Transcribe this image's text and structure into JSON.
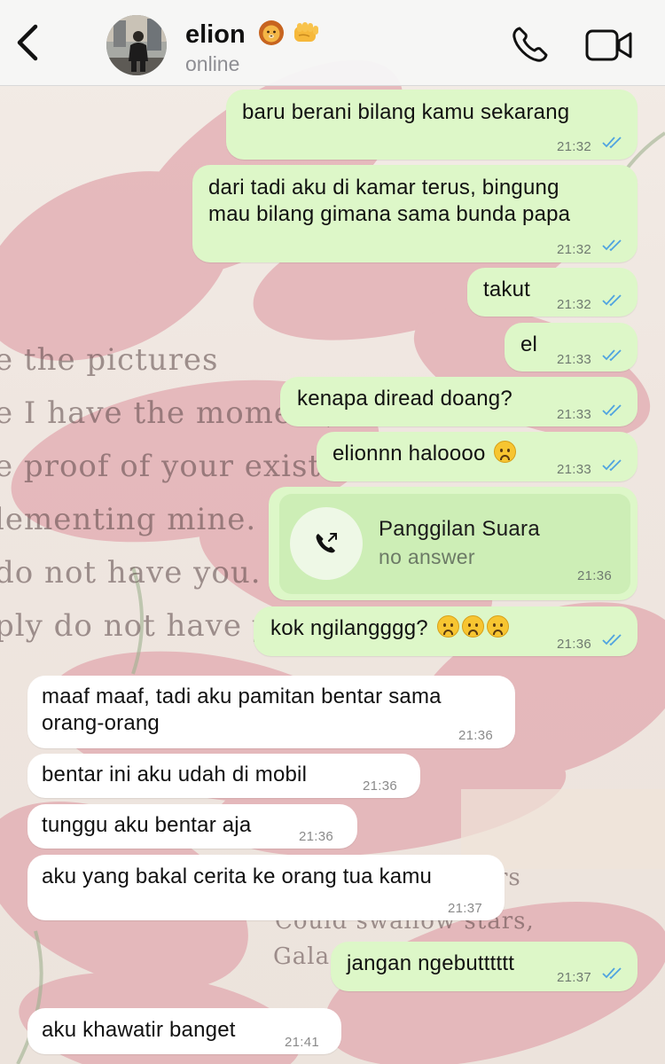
{
  "header": {
    "contact_name": "elion",
    "contact_status": "online"
  },
  "wallpaper": {
    "lines": [
      "e the pictures",
      "e I have the moment,",
      "e proof of your existe",
      "lementing mine.",
      "do not have you.",
      "ply do not have yo"
    ],
    "lower": [
      "rs",
      "Could swallow stars,",
      "Gala"
    ]
  },
  "colors": {
    "outgoing_bubble": "#ddf7c8",
    "incoming_bubble": "#ffffff",
    "read_ticks": "#4fa3e0",
    "call_card": "#cdeeb6"
  },
  "messages": [
    {
      "dir": "out",
      "lines": [
        "baru berani bilang kamu sekarang"
      ],
      "time": "21:32",
      "ticks": "read"
    },
    {
      "dir": "out",
      "lines": [
        "dari tadi aku di kamar terus, bingung",
        "mau bilang gimana sama bunda papa"
      ],
      "time": "21:32",
      "ticks": "read"
    },
    {
      "dir": "out",
      "lines": [
        "takut"
      ],
      "time": "21:32",
      "ticks": "read"
    },
    {
      "dir": "out",
      "lines": [
        "el"
      ],
      "time": "21:33",
      "ticks": "read"
    },
    {
      "dir": "out",
      "lines": [
        "kenapa diread doang?"
      ],
      "time": "21:33",
      "ticks": "read"
    },
    {
      "dir": "out",
      "lines": [
        "elionnn haloooo"
      ],
      "emoji_count": 1,
      "time": "21:33",
      "ticks": "read"
    },
    {
      "dir": "out",
      "type": "call",
      "title": "Panggilan Suara",
      "subtitle": "no answer",
      "time": "21:36"
    },
    {
      "dir": "out",
      "lines": [
        "kok ngilangggg?"
      ],
      "emoji_count": 3,
      "time": "21:36",
      "ticks": "read"
    },
    {
      "dir": "in",
      "lines": [
        "maaf maaf, tadi aku pamitan bentar sama",
        "orang-orang"
      ],
      "time": "21:36"
    },
    {
      "dir": "in",
      "lines": [
        "bentar ini aku udah di mobil"
      ],
      "time": "21:36"
    },
    {
      "dir": "in",
      "lines": [
        "tunggu aku bentar aja"
      ],
      "time": "21:36"
    },
    {
      "dir": "in",
      "lines": [
        "aku yang bakal cerita ke orang tua kamu"
      ],
      "time": "21:37"
    },
    {
      "dir": "out",
      "lines": [
        "jangan ngebutttttt"
      ],
      "time": "21:37",
      "ticks": "read"
    },
    {
      "dir": "in",
      "lines": [
        "aku khawatir banget"
      ],
      "time": "21:41"
    }
  ]
}
